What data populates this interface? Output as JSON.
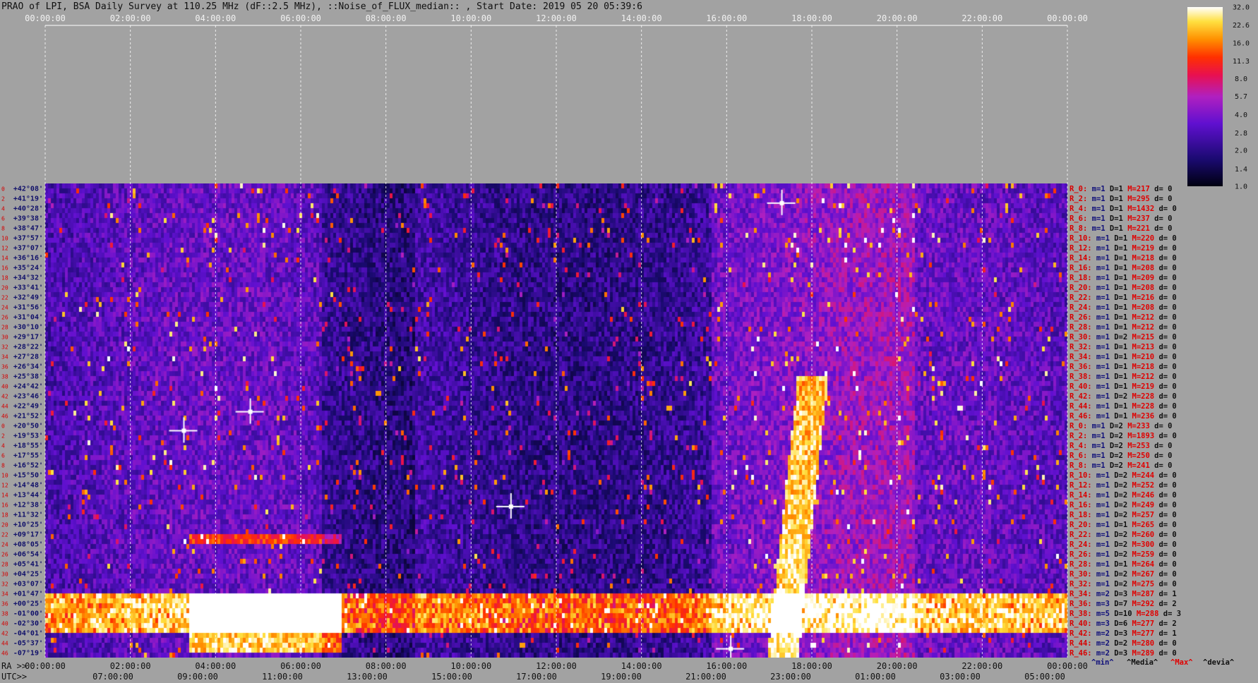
{
  "chart_data": {
    "type": "heatmap",
    "title": "PRAO of LPI, BSA Daily Survey at 110.25 MHz (dF::2.5 MHz), ::Noise_of_FLUX_median:: , Start Date: 2019 05 20 05:39:6",
    "x_top_ticks": [
      "00:00:00",
      "02:00:00",
      "04:00:00",
      "06:00:00",
      "08:00:00",
      "10:00:00",
      "12:00:00",
      "14:00:00",
      "16:00:00",
      "18:00:00",
      "20:00:00",
      "22:00:00",
      "00:00:00"
    ],
    "x_bottom_ra_prefix": "RA >>",
    "x_bottom_ra_ticks": [
      "00:00:00",
      "02:00:00",
      "04:00:00",
      "06:00:00",
      "08:00:00",
      "10:00:00",
      "12:00:00",
      "14:00:00",
      "16:00:00",
      "18:00:00",
      "20:00:00",
      "22:00:00",
      "00:00:00"
    ],
    "x_bottom_utc_prefix": "UTC>>",
    "x_bottom_utc_ticks": [
      "07:00:00",
      "09:00:00",
      "11:00:00",
      "13:00:00",
      "15:00:00",
      "17:00:00",
      "19:00:00",
      "21:00:00",
      "23:00:00",
      "01:00:00",
      "03:00:00",
      "05:00:00"
    ],
    "y_declinations": [
      "+42°08'",
      "+41°19'",
      "+40°28'",
      "+39°38'",
      "+38°47'",
      "+37°57'",
      "+37°07'",
      "+36°16'",
      "+35°24'",
      "+34°32'",
      "+33°41'",
      "+32°49'",
      "+31°56'",
      "+31°04'",
      "+30°10'",
      "+29°17'",
      "+28°22'",
      "+27°28'",
      "+26°34'",
      "+25°38'",
      "+24°42'",
      "+23°46'",
      "+22°49'",
      "+21°52'",
      "+20°50'",
      "+19°53'",
      "+18°55'",
      "+17°55'",
      "+16°52'",
      "+15°50'",
      "+14°48'",
      "+13°44'",
      "+12°38'",
      "+11°32'",
      "+10°25'",
      "+09°17'",
      "+08°05'",
      "+06°54'",
      "+05°41'",
      "+04°25'",
      "+03°07'",
      "+01°47'",
      "+00°25'",
      "-01°00'",
      "-02°30'",
      "-04°01'",
      "-05°37'",
      "-07°19'"
    ],
    "y_indices": [
      "0",
      "2",
      "4",
      "6",
      "8",
      "10",
      "12",
      "14",
      "16",
      "18",
      "20",
      "22",
      "24",
      "26",
      "28",
      "30",
      "32",
      "34",
      "36",
      "38",
      "40",
      "42",
      "44",
      "46",
      "0",
      "2",
      "4",
      "6",
      "8",
      "10",
      "12",
      "14",
      "16",
      "18",
      "20",
      "22",
      "24",
      "26",
      "28",
      "30",
      "32",
      "34",
      "36",
      "38",
      "40",
      "42",
      "44",
      "46"
    ],
    "right_stats": [
      {
        "r": "R_0:",
        "m": "m=1",
        "d": "D=1",
        "M": "M=217",
        "dd": "d= 0"
      },
      {
        "r": "R_2:",
        "m": "m=1",
        "d": "D=1",
        "M": "M=295",
        "dd": "d= 0"
      },
      {
        "r": "R_4:",
        "m": "m=1",
        "d": "D=1",
        "M": "M=1432",
        "dd": "d= 0"
      },
      {
        "r": "R_6:",
        "m": "m=1",
        "d": "D=1",
        "M": "M=237",
        "dd": "d= 0"
      },
      {
        "r": "R_8:",
        "m": "m=1",
        "d": "D=1",
        "M": "M=221",
        "dd": "d= 0"
      },
      {
        "r": "R_10:",
        "m": "m=1",
        "d": "D=1",
        "M": "M=220",
        "dd": "d= 0"
      },
      {
        "r": "R_12:",
        "m": "m=1",
        "d": "D=1",
        "M": "M=219",
        "dd": "d= 0"
      },
      {
        "r": "R_14:",
        "m": "m=1",
        "d": "D=1",
        "M": "M=218",
        "dd": "d= 0"
      },
      {
        "r": "R_16:",
        "m": "m=1",
        "d": "D=1",
        "M": "M=208",
        "dd": "d= 0"
      },
      {
        "r": "R_18:",
        "m": "m=1",
        "d": "D=1",
        "M": "M=209",
        "dd": "d= 0"
      },
      {
        "r": "R_20:",
        "m": "m=1",
        "d": "D=1",
        "M": "M=208",
        "dd": "d= 0"
      },
      {
        "r": "R_22:",
        "m": "m=1",
        "d": "D=1",
        "M": "M=216",
        "dd": "d= 0"
      },
      {
        "r": "R_24:",
        "m": "m=1",
        "d": "D=1",
        "M": "M=208",
        "dd": "d= 0"
      },
      {
        "r": "R_26:",
        "m": "m=1",
        "d": "D=1",
        "M": "M=212",
        "dd": "d= 0"
      },
      {
        "r": "R_28:",
        "m": "m=1",
        "d": "D=1",
        "M": "M=212",
        "dd": "d= 0"
      },
      {
        "r": "R_30:",
        "m": "m=1",
        "d": "D=2",
        "M": "M=215",
        "dd": "d= 0"
      },
      {
        "r": "R_32:",
        "m": "m=1",
        "d": "D=1",
        "M": "M=213",
        "dd": "d= 0"
      },
      {
        "r": "R_34:",
        "m": "m=1",
        "d": "D=1",
        "M": "M=210",
        "dd": "d= 0"
      },
      {
        "r": "R_36:",
        "m": "m=1",
        "d": "D=1",
        "M": "M=218",
        "dd": "d= 0"
      },
      {
        "r": "R_38:",
        "m": "m=1",
        "d": "D=1",
        "M": "M=212",
        "dd": "d= 0"
      },
      {
        "r": "R_40:",
        "m": "m=1",
        "d": "D=1",
        "M": "M=219",
        "dd": "d= 0"
      },
      {
        "r": "R_42:",
        "m": "m=1",
        "d": "D=2",
        "M": "M=228",
        "dd": "d= 0"
      },
      {
        "r": "R_44:",
        "m": "m=1",
        "d": "D=1",
        "M": "M=228",
        "dd": "d= 0"
      },
      {
        "r": "R_46:",
        "m": "m=1",
        "d": "D=1",
        "M": "M=236",
        "dd": "d= 0"
      },
      {
        "r": "R_0:",
        "m": "m=1",
        "d": "D=2",
        "M": "M=233",
        "dd": "d= 0"
      },
      {
        "r": "R_2:",
        "m": "m=1",
        "d": "D=2",
        "M": "M=1893",
        "dd": "d= 0"
      },
      {
        "r": "R_4:",
        "m": "m=1",
        "d": "D=2",
        "M": "M=253",
        "dd": "d= 0"
      },
      {
        "r": "R_6:",
        "m": "m=1",
        "d": "D=2",
        "M": "M=250",
        "dd": "d= 0"
      },
      {
        "r": "R_8:",
        "m": "m=1",
        "d": "D=2",
        "M": "M=241",
        "dd": "d= 0"
      },
      {
        "r": "R_10:",
        "m": "m=1",
        "d": "D=2",
        "M": "M=244",
        "dd": "d= 0"
      },
      {
        "r": "R_12:",
        "m": "m=1",
        "d": "D=2",
        "M": "M=252",
        "dd": "d= 0"
      },
      {
        "r": "R_14:",
        "m": "m=1",
        "d": "D=2",
        "M": "M=246",
        "dd": "d= 0"
      },
      {
        "r": "R_16:",
        "m": "m=1",
        "d": "D=2",
        "M": "M=249",
        "dd": "d= 0"
      },
      {
        "r": "R_18:",
        "m": "m=1",
        "d": "D=2",
        "M": "M=257",
        "dd": "d= 0"
      },
      {
        "r": "R_20:",
        "m": "m=1",
        "d": "D=1",
        "M": "M=265",
        "dd": "d= 0"
      },
      {
        "r": "R_22:",
        "m": "m=1",
        "d": "D=2",
        "M": "M=260",
        "dd": "d= 0"
      },
      {
        "r": "R_24:",
        "m": "m=1",
        "d": "D=2",
        "M": "M=300",
        "dd": "d= 0"
      },
      {
        "r": "R_26:",
        "m": "m=1",
        "d": "D=2",
        "M": "M=259",
        "dd": "d= 0"
      },
      {
        "r": "R_28:",
        "m": "m=1",
        "d": "D=1",
        "M": "M=264",
        "dd": "d= 0"
      },
      {
        "r": "R_30:",
        "m": "m=1",
        "d": "D=2",
        "M": "M=267",
        "dd": "d= 0"
      },
      {
        "r": "R_32:",
        "m": "m=1",
        "d": "D=2",
        "M": "M=275",
        "dd": "d= 0"
      },
      {
        "r": "R_34:",
        "m": "m=2",
        "d": "D=3",
        "M": "M=287",
        "dd": "d= 1"
      },
      {
        "r": "R_36:",
        "m": "m=3",
        "d": "D=7",
        "M": "M=292",
        "dd": "d= 2"
      },
      {
        "r": "R_38:",
        "m": "m=5",
        "d": "D=10",
        "M": "M=288",
        "dd": "d= 3"
      },
      {
        "r": "R_40:",
        "m": "m=3",
        "d": "D=6",
        "M": "M=277",
        "dd": "d= 2"
      },
      {
        "r": "R_42:",
        "m": "m=2",
        "d": "D=3",
        "M": "M=277",
        "dd": "d= 1"
      },
      {
        "r": "R_44:",
        "m": "m=2",
        "d": "D=2",
        "M": "M=280",
        "dd": "d= 0"
      },
      {
        "r": "R_46:",
        "m": "m=2",
        "d": "D=3",
        "M": "M=289",
        "dd": "d= 0"
      }
    ],
    "stats_legend": [
      "^min^",
      "^Media^",
      "^Max^",
      "^devia^"
    ],
    "colorbar_ticks": [
      "32.0",
      "22.6",
      "16.0",
      "11.3",
      "8.0",
      "5.7",
      "4.0",
      "2.8",
      "2.0",
      "1.4",
      "1.0"
    ],
    "colorbar_scale": "log",
    "colorbar_range": [
      1.0,
      32.0
    ],
    "colors": {
      "background": "#a2a2a2",
      "plot_dark": "#05020f",
      "stat_r": "#d80000",
      "stat_m": "#10107a",
      "stat_d": "#101010",
      "stat_M": "#e00000",
      "grid": "#ffffff"
    }
  }
}
